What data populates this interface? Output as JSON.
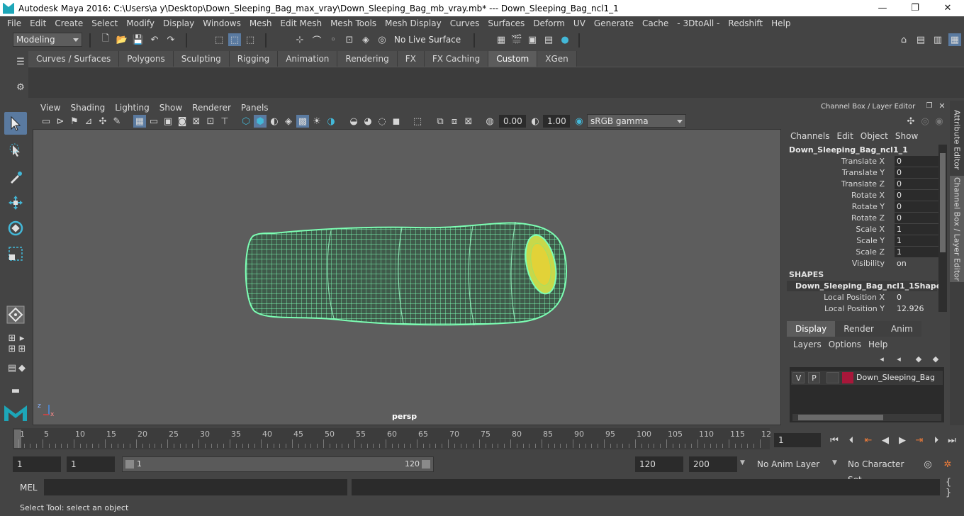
{
  "window": {
    "title": "Autodesk Maya 2016: C:\\Users\\a y\\Desktop\\Down_Sleeping_Bag_max_vray\\Down_Sleeping_Bag_mb_vray.mb*   ---   Down_Sleeping_Bag_ncl1_1",
    "minimize": "—",
    "restore": "❐",
    "close": "✕"
  },
  "menubar": {
    "items": [
      "File",
      "Edit",
      "Create",
      "Select",
      "Modify",
      "Display",
      "Windows",
      "Mesh",
      "Edit Mesh",
      "Mesh Tools",
      "Mesh Display",
      "Curves",
      "Surfaces",
      "Deform",
      "UV",
      "Generate",
      "Cache",
      "- 3DtoAll -",
      "Redshift",
      "Help"
    ]
  },
  "statusline": {
    "mode": "Modeling",
    "live_surface": "No Live Surface"
  },
  "shelf": {
    "tabs": [
      "Curves / Surfaces",
      "Polygons",
      "Sculpting",
      "Rigging",
      "Animation",
      "Rendering",
      "FX",
      "FX Caching",
      "Custom",
      "XGen"
    ],
    "active": "Custom"
  },
  "viewport": {
    "menu": [
      "View",
      "Shading",
      "Lighting",
      "Show",
      "Renderer",
      "Panels"
    ],
    "exposure": "0.00",
    "gamma": "1.00",
    "colorspace": "sRGB gamma",
    "camera": "persp",
    "axis_labels": {
      "z": "z",
      "x": "x"
    }
  },
  "channelbox": {
    "header": "Channel Box / Layer Editor",
    "menu": [
      "Channels",
      "Edit",
      "Object",
      "Show"
    ],
    "object": "Down_Sleeping_Bag_ncl1_1",
    "attrs": [
      {
        "label": "Translate X",
        "value": "0"
      },
      {
        "label": "Translate Y",
        "value": "0"
      },
      {
        "label": "Translate Z",
        "value": "0"
      },
      {
        "label": "Rotate X",
        "value": "0"
      },
      {
        "label": "Rotate Y",
        "value": "0"
      },
      {
        "label": "Rotate Z",
        "value": "0"
      },
      {
        "label": "Scale X",
        "value": "1"
      },
      {
        "label": "Scale Y",
        "value": "1"
      },
      {
        "label": "Scale Z",
        "value": "1"
      },
      {
        "label": "Visibility",
        "value": "on"
      }
    ],
    "shapes_header": "SHAPES",
    "shape_name": "Down_Sleeping_Bag_ncl1_1Shape",
    "shape_attrs": [
      {
        "label": "Local Position X",
        "value": "0"
      },
      {
        "label": "Local Position Y",
        "value": "12.926"
      }
    ]
  },
  "sidetabs": {
    "attribute_editor": "Attribute Editor",
    "channel_box": "Channel Box / Layer Editor"
  },
  "layer_editor": {
    "tabs": [
      "Display",
      "Render",
      "Anim"
    ],
    "active": "Display",
    "menu": [
      "Layers",
      "Options",
      "Help"
    ],
    "layer": {
      "v": "V",
      "p": "P",
      "name": "Down_Sleeping_Bag",
      "color": "#a8173a"
    }
  },
  "timeline": {
    "labels": [
      "1",
      "5",
      "10",
      "15",
      "20",
      "25",
      "30",
      "35",
      "40",
      "45",
      "50",
      "55",
      "60",
      "65",
      "70",
      "75",
      "80",
      "85",
      "90",
      "95",
      "100",
      "105",
      "110",
      "115",
      "12"
    ],
    "current_frame": "1"
  },
  "range": {
    "start": "1",
    "playback_start": "1",
    "slider_start": "1",
    "slider_end": "120",
    "playback_end": "120",
    "end": "200",
    "anim_layer": "No Anim Layer",
    "char_set": "No Character Set"
  },
  "cmdline": {
    "label": "MEL"
  },
  "helpline": {
    "text": "Select Tool: select an object"
  },
  "colors": {
    "wire": "#7dffb4",
    "opening": "#d7e04a",
    "selected_tool": "#5a7aa0"
  }
}
